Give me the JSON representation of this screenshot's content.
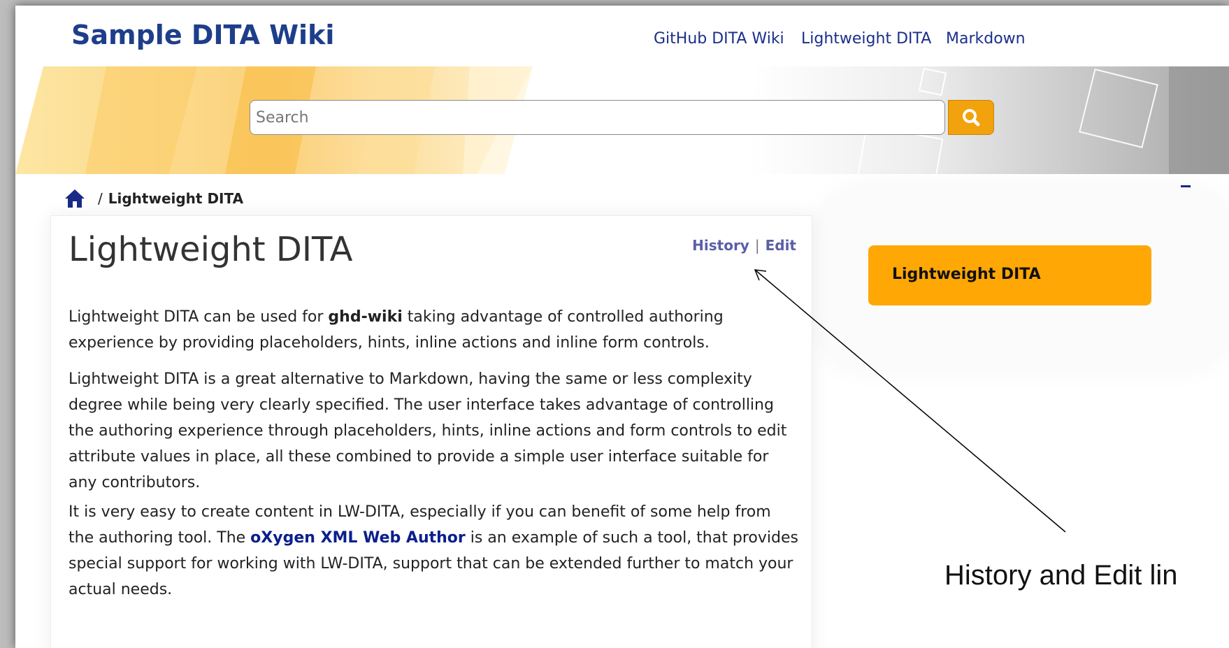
{
  "header": {
    "site_title": "Sample DITA Wiki",
    "nav": [
      {
        "label": "GitHub DITA Wiki"
      },
      {
        "label": "Lightweight DITA"
      },
      {
        "label": "Markdown"
      }
    ]
  },
  "search": {
    "placeholder": "Search",
    "value": ""
  },
  "breadcrumb": {
    "separator": "/",
    "current": "Lightweight DITA"
  },
  "article": {
    "title": "Lightweight DITA",
    "actions": {
      "history": "History",
      "separator": "|",
      "edit": "Edit"
    },
    "p1": {
      "t1": "Lightweight DITA can be used for ",
      "b1": "ghd-wiki",
      "t2": " taking advantage of controlled authoring experience by providing placeholders, hints, inline actions and inline form controls."
    },
    "p2": "Lightweight DITA is a great alternative to Markdown, having the same or less complexity degree while being very clearly specified. The user interface takes advantage of controlling the authoring experience through placeholders, hints, inline actions and form controls to edit attribute values in place, all these combined to provide a simple user interface suitable for any contributors.",
    "p3": {
      "t1": "It is very easy to create content in LW-DITA, especially if you can benefit of some help from the authoring tool. The ",
      "link": "oXygen XML Web Author",
      "t2": " is an example of such a tool, that provides special support for working with LW-DITA, support that can be extended further to match your actual needs."
    }
  },
  "sidebar": {
    "toc": [
      {
        "label": "Lightweight DITA"
      }
    ]
  },
  "annotation": {
    "text": "History and Edit lin"
  },
  "colors": {
    "brand": "#1e3e8b",
    "accent": "#ffa704",
    "link": "#0b1f8c",
    "action_link": "#5a5ea8"
  },
  "icons": [
    "home-icon",
    "search-icon",
    "print-icon"
  ]
}
